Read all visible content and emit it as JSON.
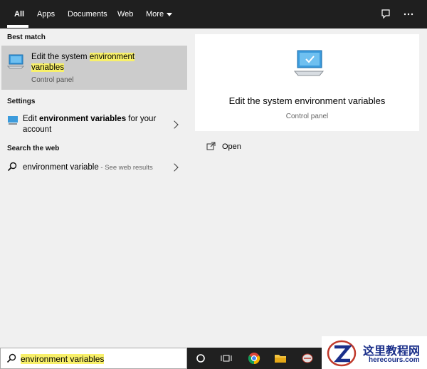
{
  "nav": {
    "tabs": [
      "All",
      "Apps",
      "Documents",
      "Web",
      "More"
    ]
  },
  "left": {
    "best_match_heading": "Best match",
    "best_match": {
      "title_prefix": "Edit the system ",
      "title_hl1": "environment",
      "title_hl2": "variables",
      "subtitle": "Control panel"
    },
    "settings_heading": "Settings",
    "settings_item": {
      "pre": "Edit ",
      "bold": "environment variables",
      "post": " for your",
      "line2": "account"
    },
    "web_heading": "Search the web",
    "web_item": {
      "query": "environment variable",
      "suffix": " - See web results"
    }
  },
  "right": {
    "title": "Edit the system environment variables",
    "subtitle": "Control panel",
    "open_label": "Open"
  },
  "taskbar": {
    "search_value": "environment variables"
  },
  "watermark": {
    "title": "这里教程网",
    "sub": "herecours.com"
  },
  "colors": {
    "highlight": "#f8f06a",
    "nav_bg": "#1f1f1f",
    "selected_bg": "#cccccc"
  }
}
